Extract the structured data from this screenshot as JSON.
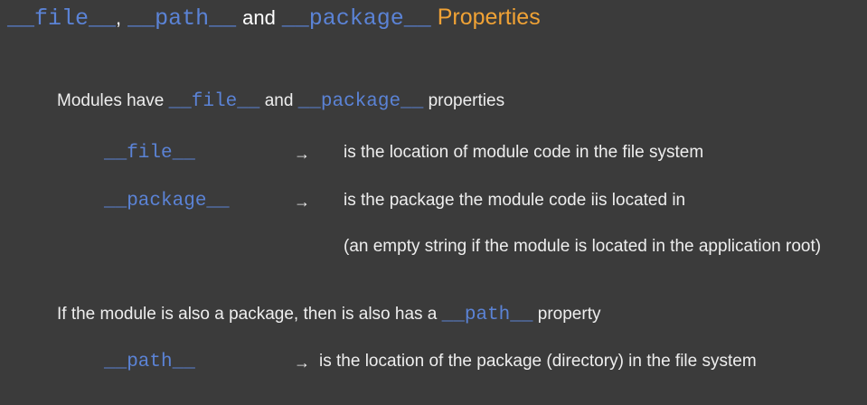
{
  "title": {
    "code_file": "__file__",
    "comma": ",",
    "code_path": "__path__",
    "and": "and",
    "code_package": "__package__",
    "properties": "Properties"
  },
  "line1": {
    "text_a": "Modules have",
    "code_file": "__file__",
    "and": "and",
    "code_package": "__package__",
    "text_b": "properties"
  },
  "file_row": {
    "code": "__file__",
    "arrow": "→",
    "desc": "is the location of module code in the file system"
  },
  "package_row": {
    "code": "__package__",
    "arrow": "→",
    "desc": "is the package the module code iis located in",
    "note": "(an empty string if the module is located in the application root)"
  },
  "line2": {
    "text_a": "If the module is also a package, then is also has a",
    "code_path": "__path__",
    "text_b": "property"
  },
  "path_row": {
    "code": "__path__",
    "arrow": "→",
    "desc": "is the location of the package (directory) in the file system"
  },
  "colors": {
    "background": "#3b3b3b",
    "code": "#5b83d6",
    "accent": "#f0a235",
    "text": "#eeeeee"
  }
}
